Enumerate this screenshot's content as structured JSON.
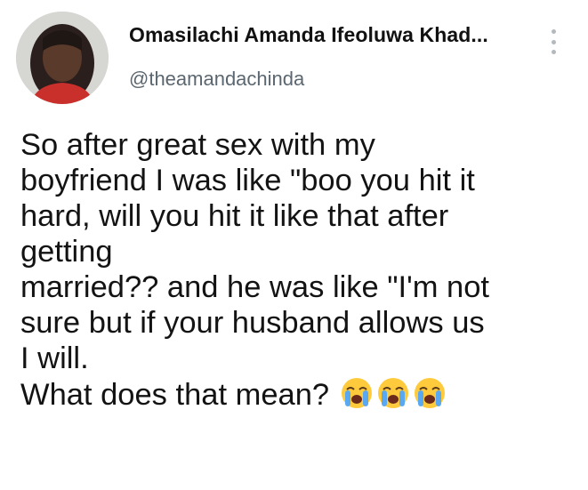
{
  "user": {
    "display_name": "Omasilachi Amanda Ifeoluwa Khad...",
    "handle": "@theamandachinda"
  },
  "icons": {
    "avatar": "profile-photo",
    "more": "more-options-icon",
    "emoji": "loudly-crying-face-icon"
  },
  "tweet": {
    "lines": [
      "So after great sex with my",
      "boyfriend I was like \"boo you hit it",
      "hard, will you hit it like that after",
      "getting",
      "married?? and he was like \"I'm not",
      "sure but if your husband allows us",
      "I will.",
      "What does that mean?"
    ]
  }
}
